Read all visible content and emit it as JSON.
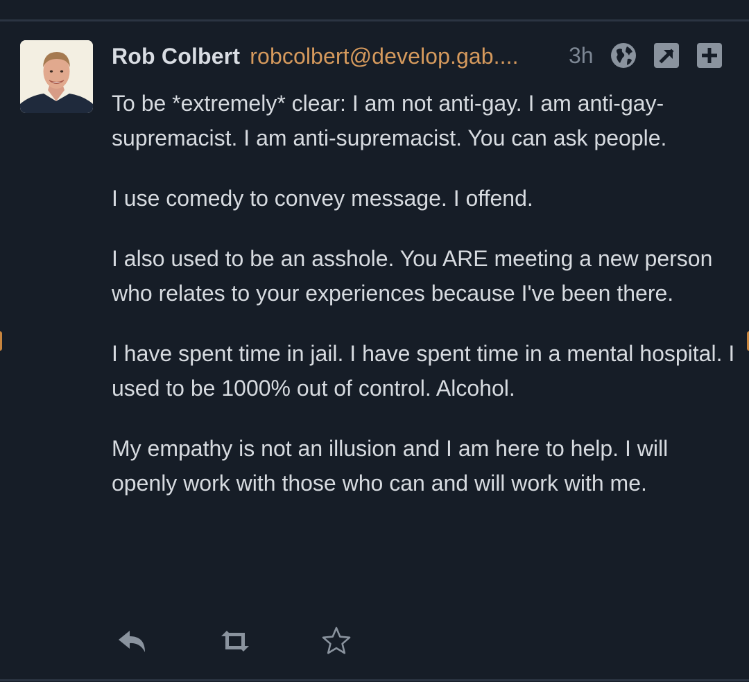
{
  "post": {
    "author": {
      "display_name": "Rob Colbert",
      "acct": "robcolbert@develop.gab...."
    },
    "relative_time": "3h",
    "visibility_icon": "globe-icon",
    "header_icons": [
      "external-link-icon",
      "expand-icon"
    ],
    "paragraphs": [
      "To be *extremely* clear: I am not anti-gay. I am anti-gay-supremacist. I am anti-supremacist. You can ask people.",
      "I use comedy to convey message. I offend.",
      "I also used to be an asshole. You ARE meeting a new person who relates to your experiences because I've been there.",
      "I have spent time in jail. I have spent time in a mental hospital. I used to be 1000% out of control. Alcohol.",
      "My empathy is not an illusion and I am here to help. I will openly work with those who can and will work with me."
    ],
    "action_icons": [
      "reply-icon",
      "boost-icon",
      "favourite-icon"
    ]
  },
  "colors": {
    "background": "#161d27",
    "text": "#d7dbe0",
    "name": "#d9dde3",
    "acct": "#d69a5d",
    "muted": "#7d8794",
    "icon": "#8a939e"
  }
}
